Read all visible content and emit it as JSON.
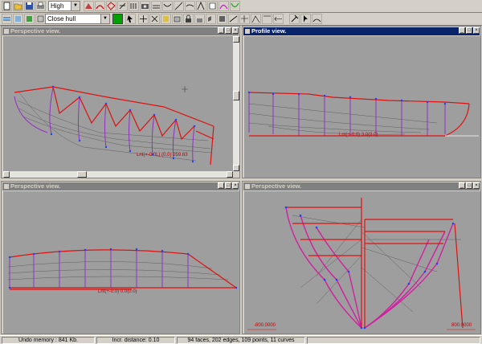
{
  "toolbar": {
    "precision_value": "High",
    "hull_action_value": "Close hull",
    "swatch_color": "#00a000"
  },
  "viewports": {
    "top_left": {
      "title": "Perspective view."
    },
    "top_right": {
      "title": "Profile view."
    },
    "bottom_left": {
      "title": "Perspective view."
    },
    "bottom_right": {
      "title": "Perspective view."
    }
  },
  "labels": {
    "tl_coord": "Lnt(+-0.0L) (0.0) 259.63",
    "tr_coord": "Lnt(+-0.0) 3.0(3.0)",
    "bl_coord": "Lnt(+-0.0) 0.0(0.0)",
    "br_left": "-800.0000",
    "br_right": "800.0000"
  },
  "status": {
    "undo_memory": "Undo memory : 841 Kb.",
    "incr_distance": "Incr. distance: 0.10",
    "summary": "94 faces, 202 edges, 109 points, 11 curves"
  },
  "colors": {
    "curve_red": "#e01010",
    "curve_purple": "#9030c0",
    "gridline": "#606060",
    "point_blue": "#2040ff"
  }
}
